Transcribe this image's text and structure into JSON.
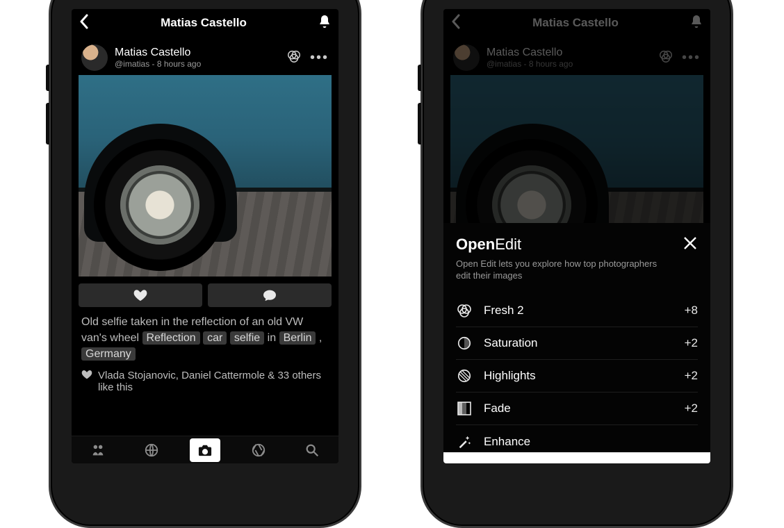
{
  "header": {
    "title": "Matias Castello"
  },
  "post": {
    "author_name": "Matias Castello",
    "author_handle": "@imatias",
    "time_ago": "8 hours ago",
    "caption_pre": "Old selfie taken in the reflection of an old VW van's wheel ",
    "caption_mid": " in ",
    "caption_sep": " , ",
    "tags": {
      "t1": "Reflection",
      "t2": "car",
      "t3": "selfie",
      "t4": "Berlin",
      "t5": "Germany"
    },
    "likes_text": "Vlada Stojanovic, Daniel Cattermole & 33 others like this"
  },
  "open_edit": {
    "title_bold": "Open",
    "title_light": "Edit",
    "subtitle": "Open Edit lets you explore how top photographers edit their images",
    "items": [
      {
        "label": "Fresh 2",
        "value": "+8"
      },
      {
        "label": "Saturation",
        "value": "+2"
      },
      {
        "label": "Highlights",
        "value": "+2"
      },
      {
        "label": "Fade",
        "value": "+2"
      },
      {
        "label": "Enhance",
        "value": ""
      }
    ]
  }
}
